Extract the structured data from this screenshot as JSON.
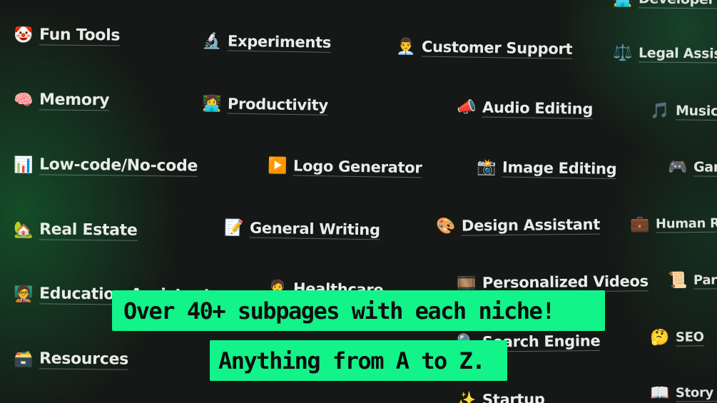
{
  "banner": {
    "line1": "Over 40+ subpages with each niche!",
    "line2": "Anything from A to Z."
  },
  "colors": {
    "background": "#151816",
    "banner_bg": "#12f389",
    "banner_text": "#0d0f0e",
    "label_text": "#e9ece9",
    "glow": "#147837"
  },
  "categories": [
    {
      "label": "Fun Tools",
      "icon": "clown-face-icon",
      "glyph": "🤡"
    },
    {
      "label": "Memory",
      "icon": "brain-icon",
      "glyph": "🧠"
    },
    {
      "label": "Low-code/No-code",
      "icon": "bar-chart-icon",
      "glyph": "📊"
    },
    {
      "label": "Real Estate",
      "icon": "house-with-garden-icon",
      "glyph": "🏡"
    },
    {
      "label": "Education Assistant",
      "icon": "teacher-icon",
      "glyph": "🧑‍🏫"
    },
    {
      "label": "Resources",
      "icon": "file-box-icon",
      "glyph": "🗃️"
    },
    {
      "label": "Experiments",
      "icon": "microscope-icon",
      "glyph": "🔬"
    },
    {
      "label": "Productivity",
      "icon": "person-at-laptop-icon",
      "glyph": "👩‍💻"
    },
    {
      "label": "Logo Generator",
      "icon": "play-button-icon",
      "glyph": "▶️"
    },
    {
      "label": "General Writing",
      "icon": "memo-icon",
      "glyph": "📝"
    },
    {
      "label": "Healthcare",
      "icon": "health-worker-icon",
      "glyph": "🧑‍⚕️"
    },
    {
      "label": "Customer Support",
      "icon": "support-person-icon",
      "glyph": "👨‍💼"
    },
    {
      "label": "Audio Editing",
      "icon": "megaphone-icon",
      "glyph": "📣"
    },
    {
      "label": "Image Editing",
      "icon": "camera-flash-icon",
      "glyph": "📸"
    },
    {
      "label": "Design Assistant",
      "icon": "palette-icon",
      "glyph": "🎨"
    },
    {
      "label": "Personalized Videos",
      "icon": "film-frames-icon",
      "glyph": "🎞️"
    },
    {
      "label": "Search Engine",
      "icon": "magnifier-icon",
      "glyph": "🔍"
    },
    {
      "label": "Startup",
      "icon": "sparkle-icon",
      "glyph": "✨"
    },
    {
      "label": "Developer Tools",
      "icon": "developer-icon",
      "glyph": "🧑‍💻"
    },
    {
      "label": "Legal Assistant",
      "icon": "balance-scale-icon",
      "glyph": "⚖️"
    },
    {
      "label": "Music",
      "icon": "musical-notes-icon",
      "glyph": "🎵"
    },
    {
      "label": "Gaming",
      "icon": "game-controller-icon",
      "glyph": "🎮"
    },
    {
      "label": "Human Resources",
      "icon": "briefcase-icon",
      "glyph": "💼"
    },
    {
      "label": "Paraphrasing",
      "icon": "scroll-icon",
      "glyph": "📜"
    },
    {
      "label": "SEO",
      "icon": "thinking-face-icon",
      "glyph": "🤔"
    },
    {
      "label": "Story Teller",
      "icon": "open-book-icon",
      "glyph": "📖"
    }
  ]
}
